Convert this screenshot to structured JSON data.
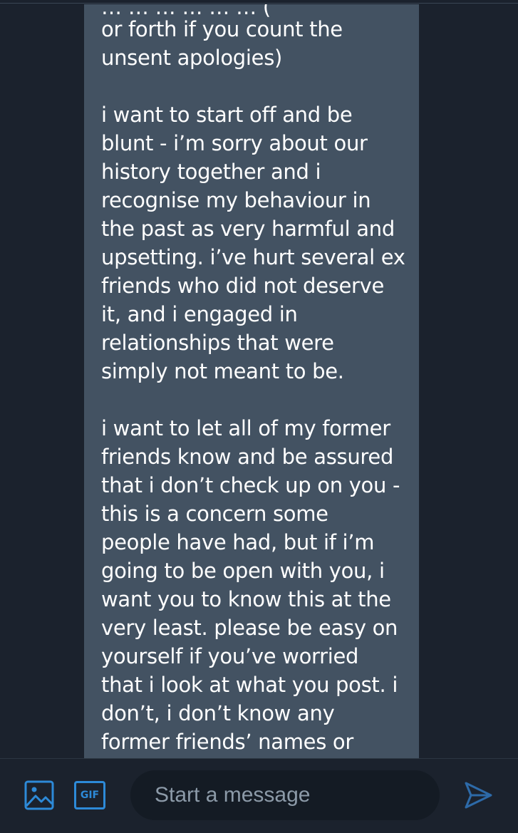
{
  "conversation": {
    "message": {
      "cut_off_line": "… … … … … … (",
      "paragraphs": [
        [
          "or forth if you count the",
          "unsent apologies)"
        ],
        [
          "i want to start off and be",
          "blunt - i’m sorry about our",
          "history together and i",
          "recognise my behaviour in",
          "the past as very harmful and",
          "upsetting. i’ve hurt several ex",
          "friends who did not deserve",
          "it, and i engaged in",
          "relationships that were",
          "simply not meant to be."
        ],
        [
          "i want to let all of my former",
          "friends know and be assured",
          "that i don’t check up on you -",
          "this is a concern some",
          "people have had, but if i’m",
          "going to be open with you, i",
          "want you to know this at the",
          "very least. please be easy on",
          "yourself if you’ve worried",
          "that i look at what you post. i",
          "don’t, i don’t know any",
          "former friends’ names or"
        ]
      ]
    }
  },
  "composer": {
    "media_icon": "image-icon",
    "gif_label": "GIF",
    "placeholder": "Start a message",
    "send_icon": "send-icon"
  },
  "colors": {
    "background": "#1b222d",
    "bubble": "#435262",
    "accent": "#2d8ad8",
    "input_background": "#141b24",
    "placeholder": "#8c9aa8"
  }
}
